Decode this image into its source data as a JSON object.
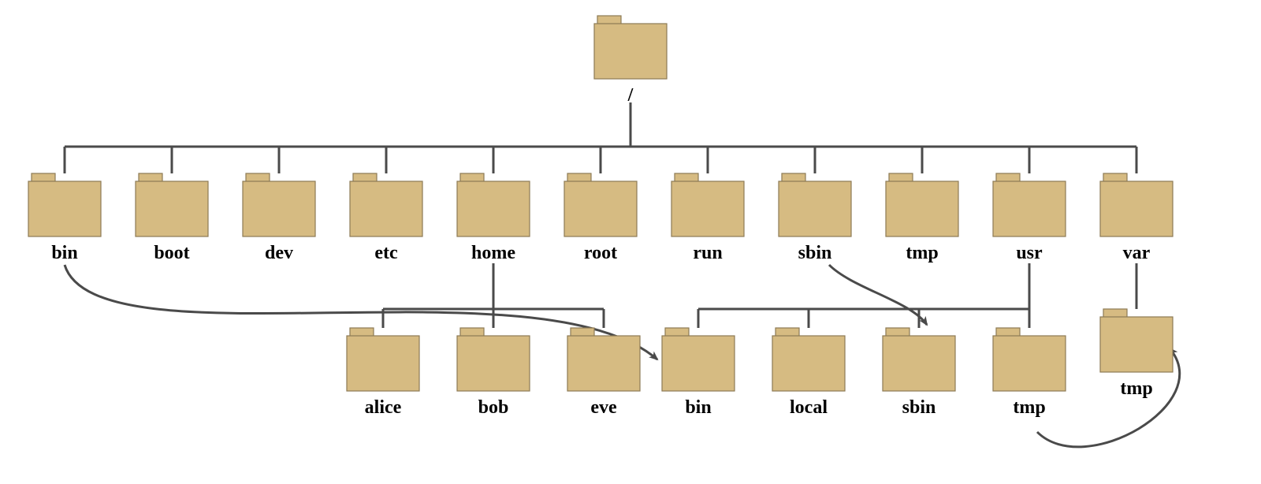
{
  "colors": {
    "folder_fill": "#d6bb82",
    "folder_stroke": "#8c7a55",
    "line": "#4a4a4a"
  },
  "root": {
    "label": "/"
  },
  "level1": [
    {
      "id": "bin",
      "label": "bin"
    },
    {
      "id": "boot",
      "label": "boot"
    },
    {
      "id": "dev",
      "label": "dev"
    },
    {
      "id": "etc",
      "label": "etc"
    },
    {
      "id": "home",
      "label": "home"
    },
    {
      "id": "root",
      "label": "root"
    },
    {
      "id": "run",
      "label": "run"
    },
    {
      "id": "sbin",
      "label": "sbin"
    },
    {
      "id": "tmp",
      "label": "tmp"
    },
    {
      "id": "usr",
      "label": "usr"
    },
    {
      "id": "var",
      "label": "var"
    }
  ],
  "home_children": [
    {
      "id": "alice",
      "label": "alice"
    },
    {
      "id": "bob",
      "label": "bob"
    },
    {
      "id": "eve",
      "label": "eve"
    }
  ],
  "usr_children": [
    {
      "id": "usr_bin",
      "label": "bin"
    },
    {
      "id": "usr_local",
      "label": "local"
    },
    {
      "id": "usr_sbin",
      "label": "sbin"
    },
    {
      "id": "usr_tmp",
      "label": "tmp"
    }
  ],
  "var_children": [
    {
      "id": "var_tmp",
      "label": "tmp"
    }
  ],
  "symlinks": [
    {
      "from": "bin",
      "to": "usr_bin"
    },
    {
      "from": "sbin",
      "to": "usr_sbin"
    },
    {
      "from": "usr_tmp",
      "to": "var_tmp"
    }
  ]
}
